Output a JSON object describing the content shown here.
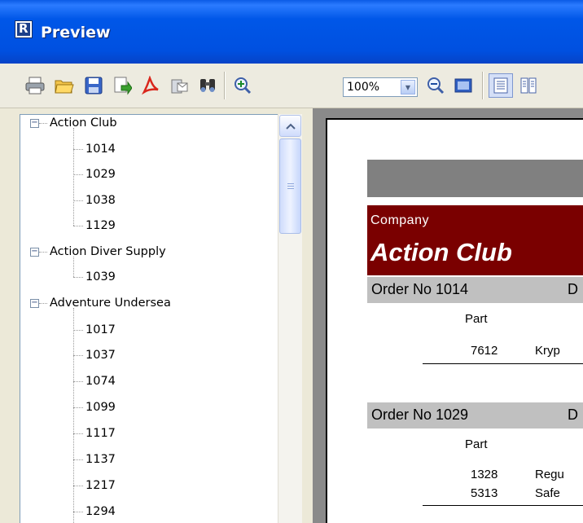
{
  "window": {
    "title": "Preview",
    "app_icon_letter": "R"
  },
  "toolbar": {
    "buttons": [
      "print-icon",
      "open-icon",
      "save-icon",
      "export-icon",
      "pdf-icon",
      "email-icon",
      "find-icon",
      "zoom-in-icon",
      "zoom-out-icon",
      "fullscreen-icon",
      "single-page-icon",
      "multi-page-icon"
    ],
    "zoom_value": "100%"
  },
  "tree": {
    "groups": [
      {
        "label": "Action Club",
        "expanded": true,
        "items": [
          "1014",
          "1029",
          "1038",
          "1129"
        ]
      },
      {
        "label": "Action Diver Supply",
        "expanded": true,
        "items": [
          "1039"
        ]
      },
      {
        "label": "Adventure Undersea",
        "expanded": true,
        "items": [
          "1017",
          "1037",
          "1074",
          "1099",
          "1117",
          "1137",
          "1217",
          "1294"
        ]
      }
    ]
  },
  "report": {
    "company_label": "Company",
    "company_name": "Action Club",
    "orders": [
      {
        "order": "Order No 1014",
        "d": "D",
        "part_header": "Part",
        "rows": [
          {
            "part": "7612",
            "desc": "Kryp"
          }
        ]
      },
      {
        "order": "Order No 1029",
        "d": "D",
        "part_header": "Part",
        "rows": [
          {
            "part": "1328",
            "desc": "Regu"
          },
          {
            "part": "5313",
            "desc": "Safe"
          }
        ]
      }
    ]
  },
  "colors": {
    "titlebar": "#0054E3",
    "company_band": "#7A0000",
    "order_bar": "#C0C0C0",
    "preview_bg": "#8A8A8A"
  }
}
